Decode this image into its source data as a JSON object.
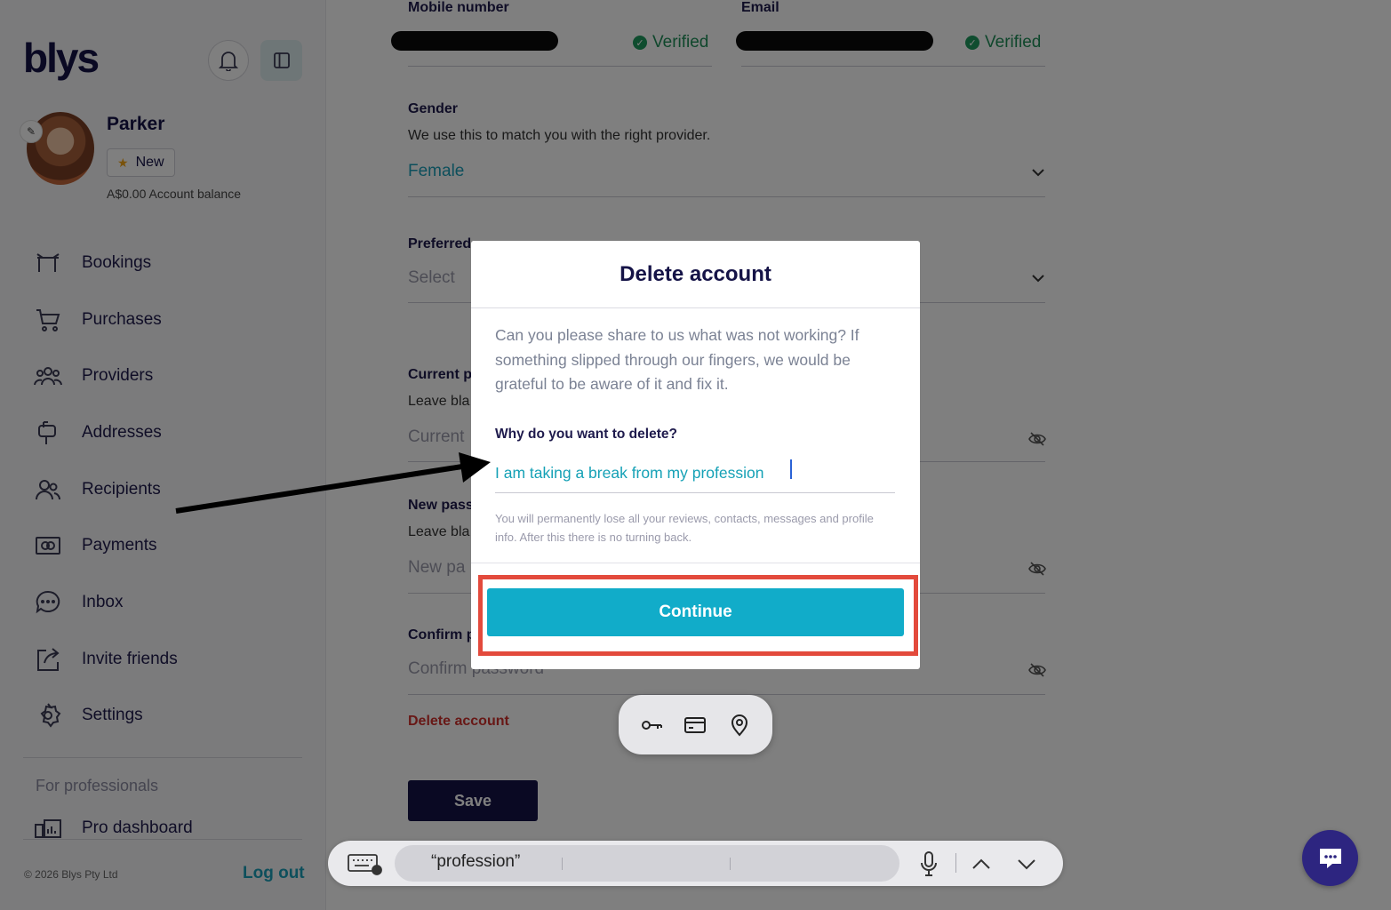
{
  "sidebar": {
    "logo": "blys",
    "user": {
      "name": "Parker",
      "badge": "New",
      "balance": "A$0.00 Account balance"
    },
    "nav": [
      {
        "label": "Bookings",
        "icon": "bookings-icon"
      },
      {
        "label": "Purchases",
        "icon": "cart-icon"
      },
      {
        "label": "Providers",
        "icon": "providers-icon"
      },
      {
        "label": "Addresses",
        "icon": "mailbox-icon"
      },
      {
        "label": "Recipients",
        "icon": "recipients-icon"
      },
      {
        "label": "Payments",
        "icon": "payments-icon"
      },
      {
        "label": "Inbox",
        "icon": "chat-bubble-icon"
      },
      {
        "label": "Invite friends",
        "icon": "share-icon"
      },
      {
        "label": "Settings",
        "icon": "gear-icon"
      }
    ],
    "pro_heading": "For professionals",
    "pro_item": "Pro dashboard",
    "copyright": "© 2026 Blys Pty Ltd",
    "logout": "Log out"
  },
  "form": {
    "mobile_label": "Mobile number",
    "email_label": "Email",
    "verified": "Verified",
    "gender_label": "Gender",
    "gender_hint": "We use this to match you with the right provider.",
    "gender_value": "Female",
    "preferred_label": "Preferred",
    "preferred_value": "Select",
    "current_label": "Current p",
    "current_hint": "Leave bla",
    "current_placeholder": "Current",
    "new_label": "New pass",
    "new_hint": "Leave bla",
    "new_placeholder": "New pa",
    "confirm_label": "Confirm p",
    "confirm_placeholder": "Confirm password",
    "delete_link": "Delete account",
    "save": "Save"
  },
  "modal": {
    "title": "Delete account",
    "intro": "Can you please share to us what was not working? If something slipped through our fingers, we would be grateful to be aware of it and fix it.",
    "reason_label": "Why do you want to delete?",
    "reason_value": "I am taking a break from my profession",
    "warning": "You will permanently lose all your reviews, contacts, messages and profile info. After this there is no turning back.",
    "continue": "Continue"
  },
  "keyboard_bar": {
    "suggestion": "“profession”"
  },
  "colors": {
    "brand_navy": "#151347",
    "accent_teal": "#11acc9",
    "danger": "#d0312d",
    "highlight": "#e34a3c",
    "verified_green": "#1f8f58"
  }
}
